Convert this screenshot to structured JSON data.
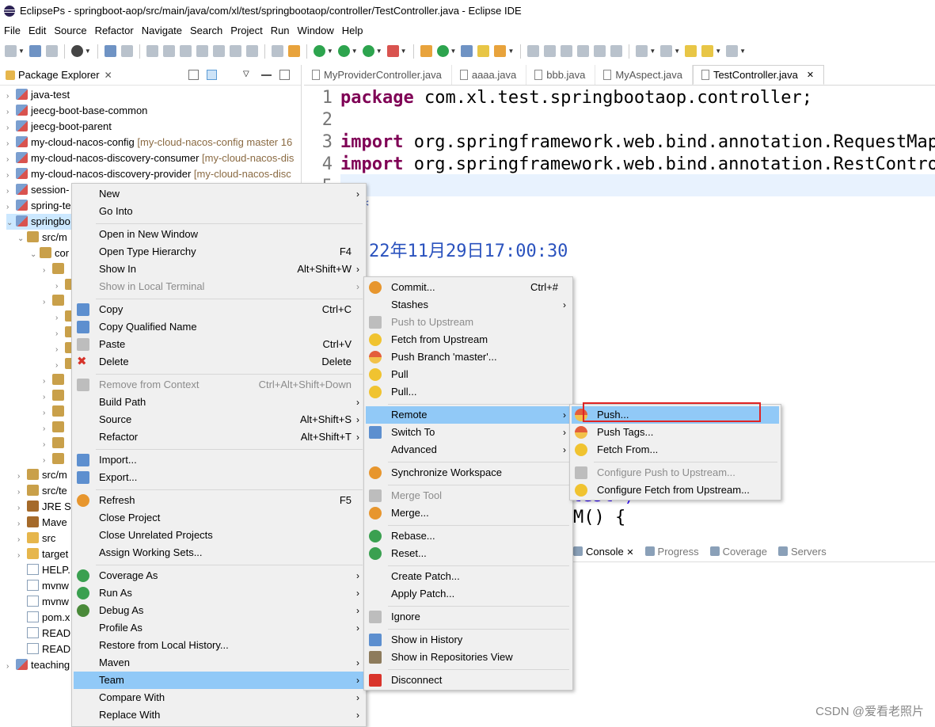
{
  "window": {
    "title": "EclipsePs - springboot-aop/src/main/java/com/xl/test/springbootaop/controller/TestController.java - Eclipse IDE"
  },
  "menubar": [
    "File",
    "Edit",
    "Source",
    "Refactor",
    "Navigate",
    "Search",
    "Project",
    "Run",
    "Window",
    "Help"
  ],
  "package_explorer": {
    "title": "Package Explorer",
    "rows": [
      {
        "label": "java-test",
        "dec": ""
      },
      {
        "label": "jeecg-boot-base-common",
        "dec": ""
      },
      {
        "label": "jeecg-boot-parent",
        "dec": ""
      },
      {
        "label": "my-cloud-nacos-config",
        "dec": "[my-cloud-nacos-config master 16"
      },
      {
        "label": "my-cloud-nacos-discovery-consumer",
        "dec": "[my-cloud-nacos-dis"
      },
      {
        "label": "my-cloud-nacos-discovery-provider",
        "dec": "[my-cloud-nacos-disc"
      },
      {
        "label": "session-",
        "dec": ""
      },
      {
        "label": "spring-te",
        "dec": ""
      },
      {
        "label": "springbo",
        "dec": ""
      },
      {
        "label": "src/m",
        "dec": ""
      },
      {
        "label": "cor",
        "dec": ""
      },
      {
        "label": "src/m",
        "dec": ""
      },
      {
        "label": "src/te",
        "dec": ""
      },
      {
        "label": "JRE S",
        "dec": ""
      },
      {
        "label": "Mave",
        "dec": ""
      },
      {
        "label": "src",
        "dec": ""
      },
      {
        "label": "target",
        "dec": ""
      },
      {
        "label": "HELP.",
        "dec": ""
      },
      {
        "label": "mvnw",
        "dec": ""
      },
      {
        "label": "mvnw",
        "dec": ""
      },
      {
        "label": "pom.x",
        "dec": ""
      },
      {
        "label": "READ",
        "dec": ""
      },
      {
        "label": "READ",
        "dec": ""
      },
      {
        "label": "teaching",
        "dec": ""
      }
    ]
  },
  "editor": {
    "tabs": [
      "MyProviderController.java",
      "aaaa.java",
      "bbb.java",
      "MyAspect.java",
      "TestController.java"
    ],
    "lines": [
      {
        "num": "1",
        "kw": "package",
        "rest": " com.xl.test.springbootaop.controller;"
      },
      {
        "num": "2",
        "kw": "",
        "rest": ""
      },
      {
        "num": "3",
        "kw": "import",
        "rest": " org.springframework.web.bind.annotation.RequestMap"
      },
      {
        "num": "4",
        "kw": "import",
        "rest": " org.springframework.web.bind.annotation.RestContro"
      },
      {
        "num": "5",
        "kw": "",
        "rest": ""
      }
    ],
    "fragment_star": "*",
    "fragment_date": "22年11月29日17:00:30",
    "fragment_a": "test\")",
    "fragment_b": "M() {"
  },
  "bottom_tabs": [
    "Console",
    "Progress",
    "Coverage",
    "Servers"
  ],
  "context_menu": [
    {
      "label": "New",
      "acc": "",
      "sub": true,
      "state": "normal",
      "icon": ""
    },
    {
      "label": "Go Into",
      "acc": "",
      "sub": false,
      "state": "normal",
      "icon": ""
    },
    {
      "sep": true
    },
    {
      "label": "Open in New Window",
      "acc": "",
      "sub": false,
      "state": "normal",
      "icon": ""
    },
    {
      "label": "Open Type Hierarchy",
      "acc": "F4",
      "sub": false,
      "state": "normal",
      "icon": ""
    },
    {
      "label": "Show In",
      "acc": "Alt+Shift+W",
      "sub": true,
      "state": "normal",
      "icon": ""
    },
    {
      "label": "Show in Local Terminal",
      "acc": "",
      "sub": true,
      "state": "disabled",
      "icon": ""
    },
    {
      "sep": true
    },
    {
      "label": "Copy",
      "acc": "Ctrl+C",
      "sub": false,
      "state": "normal",
      "icon": "ic-blue"
    },
    {
      "label": "Copy Qualified Name",
      "acc": "",
      "sub": false,
      "state": "normal",
      "icon": "ic-blue"
    },
    {
      "label": "Paste",
      "acc": "Ctrl+V",
      "sub": false,
      "state": "normal",
      "icon": "ic-gray"
    },
    {
      "label": "Delete",
      "acc": "Delete",
      "sub": false,
      "state": "normal",
      "icon": "ic-x"
    },
    {
      "sep": true
    },
    {
      "label": "Remove from Context",
      "acc": "Ctrl+Alt+Shift+Down",
      "sub": false,
      "state": "disabled",
      "icon": "ic-gray"
    },
    {
      "label": "Build Path",
      "acc": "",
      "sub": true,
      "state": "normal",
      "icon": ""
    },
    {
      "label": "Source",
      "acc": "Alt+Shift+S",
      "sub": true,
      "state": "normal",
      "icon": ""
    },
    {
      "label": "Refactor",
      "acc": "Alt+Shift+T",
      "sub": true,
      "state": "normal",
      "icon": ""
    },
    {
      "sep": true
    },
    {
      "label": "Import...",
      "acc": "",
      "sub": false,
      "state": "normal",
      "icon": "ic-blue"
    },
    {
      "label": "Export...",
      "acc": "",
      "sub": false,
      "state": "normal",
      "icon": "ic-blue"
    },
    {
      "sep": true
    },
    {
      "label": "Refresh",
      "acc": "F5",
      "sub": false,
      "state": "normal",
      "icon": "ic-orange"
    },
    {
      "label": "Close Project",
      "acc": "",
      "sub": false,
      "state": "normal",
      "icon": ""
    },
    {
      "label": "Close Unrelated Projects",
      "acc": "",
      "sub": false,
      "state": "normal",
      "icon": ""
    },
    {
      "label": "Assign Working Sets...",
      "acc": "",
      "sub": false,
      "state": "normal",
      "icon": ""
    },
    {
      "sep": true
    },
    {
      "label": "Coverage As",
      "acc": "",
      "sub": true,
      "state": "normal",
      "icon": "ic-green"
    },
    {
      "label": "Run As",
      "acc": "",
      "sub": true,
      "state": "normal",
      "icon": "ic-green"
    },
    {
      "label": "Debug As",
      "acc": "",
      "sub": true,
      "state": "normal",
      "icon": "ic-bug"
    },
    {
      "label": "Profile As",
      "acc": "",
      "sub": true,
      "state": "normal",
      "icon": ""
    },
    {
      "label": "Restore from Local History...",
      "acc": "",
      "sub": false,
      "state": "normal",
      "icon": ""
    },
    {
      "label": "Maven",
      "acc": "",
      "sub": true,
      "state": "normal",
      "icon": ""
    },
    {
      "label": "Team",
      "acc": "",
      "sub": true,
      "state": "hl",
      "icon": ""
    },
    {
      "label": "Compare With",
      "acc": "",
      "sub": true,
      "state": "normal",
      "icon": ""
    },
    {
      "label": "Replace With",
      "acc": "",
      "sub": true,
      "state": "normal",
      "icon": ""
    }
  ],
  "team_menu": [
    {
      "label": "Commit...",
      "acc": "Ctrl+#",
      "sub": false,
      "state": "normal",
      "icon": "ic-orange"
    },
    {
      "label": "Stashes",
      "acc": "",
      "sub": true,
      "state": "normal",
      "icon": ""
    },
    {
      "label": "Push to Upstream",
      "acc": "",
      "sub": false,
      "state": "disabled",
      "icon": "ic-gray"
    },
    {
      "label": "Fetch from Upstream",
      "acc": "",
      "sub": false,
      "state": "normal",
      "icon": "ic-yellow"
    },
    {
      "label": "Push Branch 'master'...",
      "acc": "",
      "sub": false,
      "state": "normal",
      "icon": "ic-orange-up"
    },
    {
      "label": "Pull",
      "acc": "",
      "sub": false,
      "state": "normal",
      "icon": "ic-yellow"
    },
    {
      "label": "Pull...",
      "acc": "",
      "sub": false,
      "state": "normal",
      "icon": "ic-yellow"
    },
    {
      "sep": true
    },
    {
      "label": "Remote",
      "acc": "",
      "sub": true,
      "state": "hl",
      "icon": ""
    },
    {
      "label": "Switch To",
      "acc": "",
      "sub": true,
      "state": "normal",
      "icon": "ic-blue"
    },
    {
      "label": "Advanced",
      "acc": "",
      "sub": true,
      "state": "normal",
      "icon": ""
    },
    {
      "sep": true
    },
    {
      "label": "Synchronize Workspace",
      "acc": "",
      "sub": false,
      "state": "normal",
      "icon": "ic-orange"
    },
    {
      "sep": true
    },
    {
      "label": "Merge Tool",
      "acc": "",
      "sub": false,
      "state": "disabled",
      "icon": "ic-gray"
    },
    {
      "label": "Merge...",
      "acc": "",
      "sub": false,
      "state": "normal",
      "icon": "ic-orange"
    },
    {
      "sep": true
    },
    {
      "label": "Rebase...",
      "acc": "",
      "sub": false,
      "state": "normal",
      "icon": "ic-green"
    },
    {
      "label": "Reset...",
      "acc": "",
      "sub": false,
      "state": "normal",
      "icon": "ic-green"
    },
    {
      "sep": true
    },
    {
      "label": "Create Patch...",
      "acc": "",
      "sub": false,
      "state": "normal",
      "icon": ""
    },
    {
      "label": "Apply Patch...",
      "acc": "",
      "sub": false,
      "state": "normal",
      "icon": ""
    },
    {
      "sep": true
    },
    {
      "label": "Ignore",
      "acc": "",
      "sub": false,
      "state": "normal",
      "icon": "ic-gray"
    },
    {
      "sep": true
    },
    {
      "label": "Show in History",
      "acc": "",
      "sub": false,
      "state": "normal",
      "icon": "ic-blue"
    },
    {
      "label": "Show in Repositories View",
      "acc": "",
      "sub": false,
      "state": "normal",
      "icon": "ic-git"
    },
    {
      "sep": true
    },
    {
      "label": "Disconnect",
      "acc": "",
      "sub": false,
      "state": "normal",
      "icon": "ic-red"
    }
  ],
  "remote_menu": [
    {
      "label": "Push...",
      "acc": "",
      "sub": false,
      "state": "hl",
      "icon": "ic-orange-up"
    },
    {
      "label": "Push Tags...",
      "acc": "",
      "sub": false,
      "state": "normal",
      "icon": "ic-orange-up"
    },
    {
      "label": "Fetch From...",
      "acc": "",
      "sub": false,
      "state": "normal",
      "icon": "ic-yellow"
    },
    {
      "sep": true
    },
    {
      "label": "Configure Push to Upstream...",
      "acc": "",
      "sub": false,
      "state": "disabled",
      "icon": "ic-gray"
    },
    {
      "label": "Configure Fetch from Upstream...",
      "acc": "",
      "sub": false,
      "state": "normal",
      "icon": "ic-yellow"
    }
  ],
  "watermark": "CSDN @爱看老照片"
}
